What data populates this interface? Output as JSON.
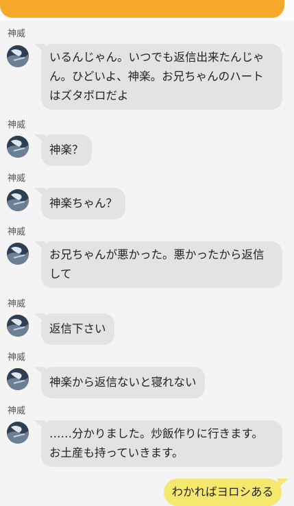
{
  "messages": [
    {
      "sender": "神威",
      "text": "いるんじゃん。いつでも返信出来たんじゃん。ひどいよ、神楽。お兄ちゃんのハートはズタボロだよ"
    },
    {
      "sender": "神威",
      "text": "神楽？"
    },
    {
      "sender": "神威",
      "text": "神楽ちゃん？"
    },
    {
      "sender": "神威",
      "text": "お兄ちゃんが悪かった。悪かったから返信して"
    },
    {
      "sender": "神威",
      "text": "返信下さい"
    },
    {
      "sender": "神威",
      "text": "神楽から返信ないと寝れない"
    },
    {
      "sender": "神威",
      "text": "……分かりました。炒飯作りに行きます。お土産も持っていきます。"
    }
  ],
  "my_message": {
    "text": "わかればヨロシある"
  },
  "colors": {
    "incoming_bubble": "#e3e3e3",
    "outgoing_bubble": "#f4e86e",
    "accent": "#f8a82a"
  },
  "icons": {
    "avatar": "avatar-image"
  }
}
